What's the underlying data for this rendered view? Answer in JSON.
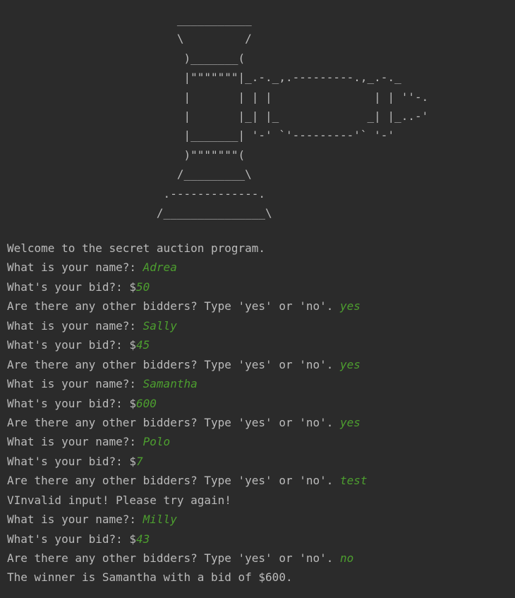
{
  "ascii_art": [
    "                         ___________",
    "                         \\         /",
    "                          )_______(",
    "                          |\"\"\"\"\"\"\"|_.-._,.---------.,_.-._",
    "                          |       | | |               | | ''-.",
    "                          |       |_| |_             _| |_..-'",
    "                          |_______| '-' `'---------'` '-'",
    "                          )\"\"\"\"\"\"\"(",
    "                         /_________\\",
    "                       .-------------.",
    "                      /_______________\\"
  ],
  "lines": [
    {
      "prompt": "Welcome to the secret auction program.",
      "input": ""
    },
    {
      "prompt": "What is your name?: ",
      "input": "Adrea"
    },
    {
      "prompt": "What's your bid?: $",
      "input": "50"
    },
    {
      "prompt": "Are there any other bidders? Type 'yes' or 'no'. ",
      "input": "yes"
    },
    {
      "prompt": "What is your name?: ",
      "input": "Sally"
    },
    {
      "prompt": "What's your bid?: $",
      "input": "45"
    },
    {
      "prompt": "Are there any other bidders? Type 'yes' or 'no'. ",
      "input": "yes"
    },
    {
      "prompt": "What is your name?: ",
      "input": "Samantha"
    },
    {
      "prompt": "What's your bid?: $",
      "input": "600"
    },
    {
      "prompt": "Are there any other bidders? Type 'yes' or 'no'. ",
      "input": "yes"
    },
    {
      "prompt": "What is your name?: ",
      "input": "Polo"
    },
    {
      "prompt": "What's your bid?: $",
      "input": "7"
    },
    {
      "prompt": "Are there any other bidders? Type 'yes' or 'no'. ",
      "input": "test"
    },
    {
      "prompt": "VInvalid input! Please try again!",
      "input": ""
    },
    {
      "prompt": "What is your name?: ",
      "input": "Milly"
    },
    {
      "prompt": "What's your bid?: $",
      "input": "43"
    },
    {
      "prompt": "Are there any other bidders? Type 'yes' or 'no'. ",
      "input": "no"
    },
    {
      "prompt": "The winner is Samantha with a bid of $600.",
      "input": ""
    }
  ]
}
